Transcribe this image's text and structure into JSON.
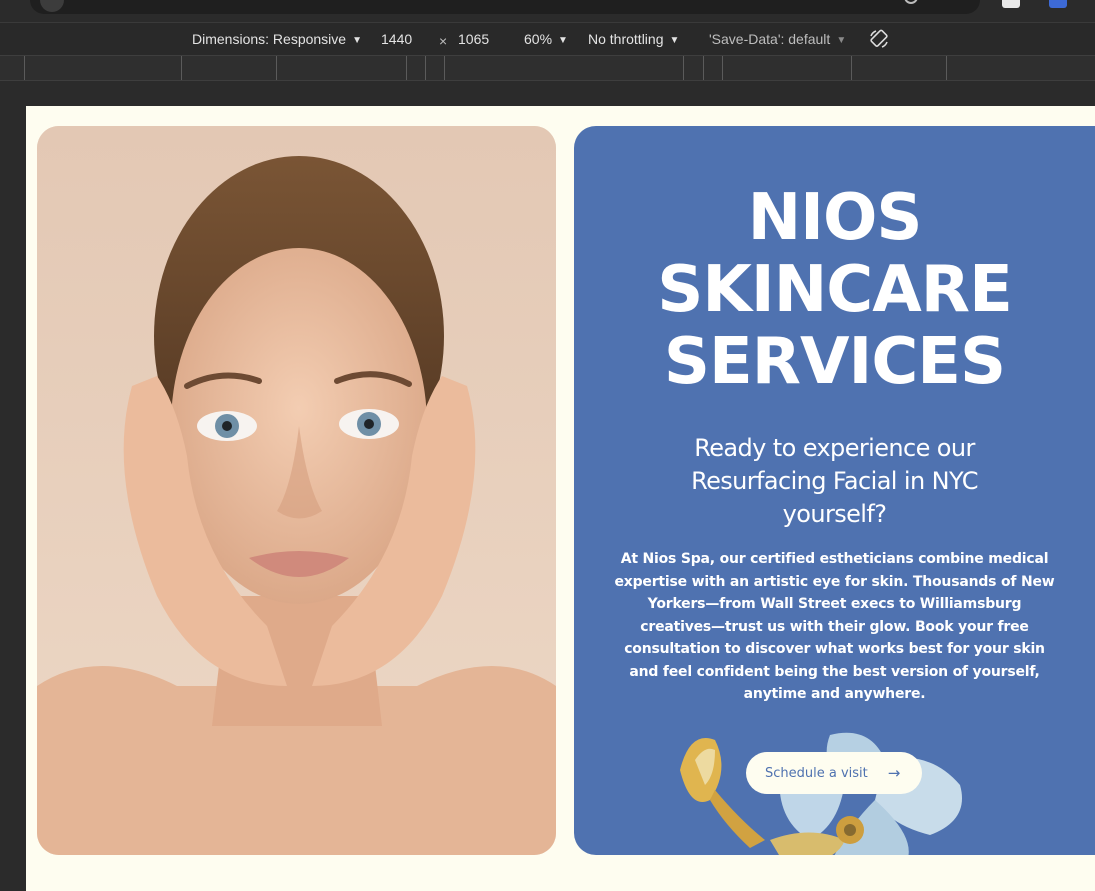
{
  "devtools": {
    "dimensions_label": "Dimensions: Responsive",
    "width": "1440",
    "times": "×",
    "height": "1065",
    "zoom": "60%",
    "throttling": "No throttling",
    "save_data": "'Save-Data': default",
    "dropdown_glyph": "▼"
  },
  "hero": {
    "title_lines": [
      "NIOS",
      "SKINCARE",
      "SERVICES"
    ],
    "subtitle": "Ready to experience our Resurfacing Facial in NYC yourself?",
    "body": "At Nios Spa, our certified estheticians combine medical expertise with an artistic eye for skin. Thousands of New Yorkers—from Wall Street execs to Williamsburg creatives—trust us with their glow. Book your free consultation to discover what works best for your skin and feel confident being the best version of yourself, anytime and anywhere.",
    "cta_label": "Schedule a visit",
    "cta_arrow": "→"
  },
  "colors": {
    "page_bg": "#fefdf0",
    "card_blue": "#4f72b0",
    "devtools_bg": "#292929"
  }
}
